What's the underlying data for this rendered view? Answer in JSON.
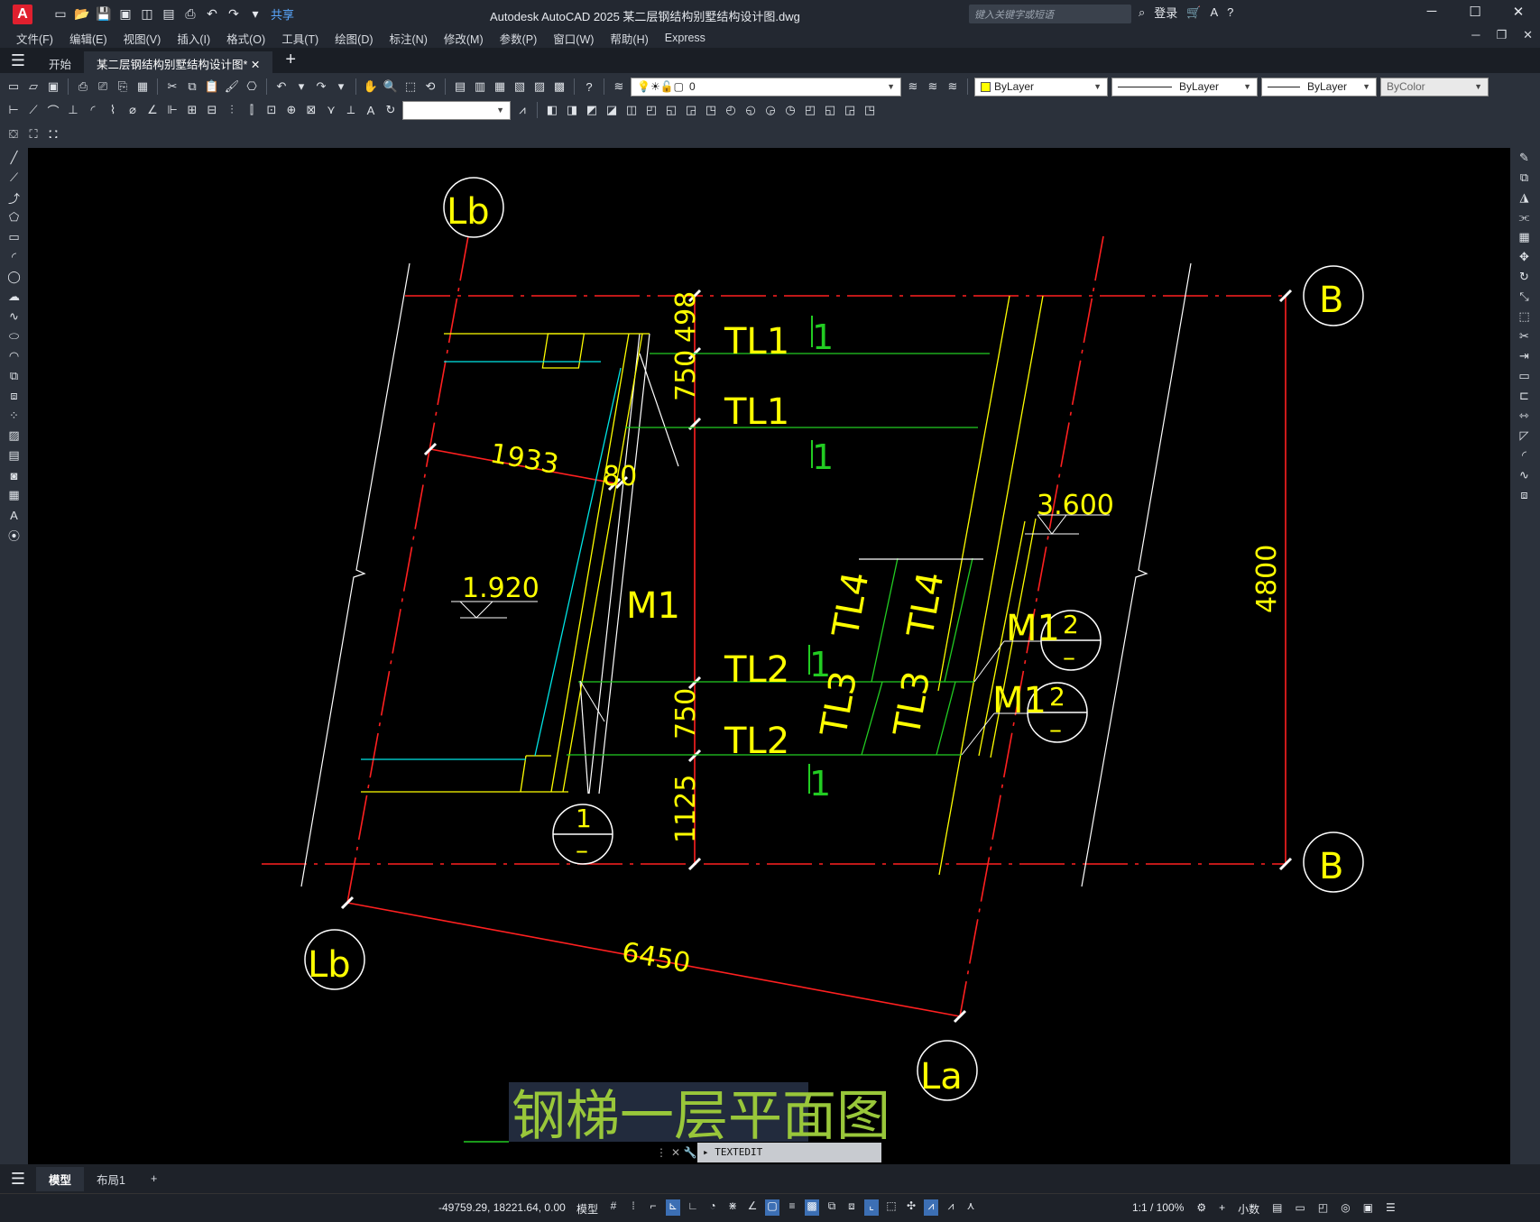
{
  "app": {
    "title": "Autodesk AutoCAD 2025    某二层钢结构别墅结构设计图.dwg",
    "logo": "A",
    "share": "共享",
    "search_placeholder": "键入关键字或短语",
    "login": "登录"
  },
  "menu": [
    "文件(F)",
    "编辑(E)",
    "视图(V)",
    "插入(I)",
    "格式(O)",
    "工具(T)",
    "绘图(D)",
    "标注(N)",
    "修改(M)",
    "参数(P)",
    "窗口(W)",
    "帮助(H)",
    "Express"
  ],
  "tabs": {
    "start": "开始",
    "active": "某二层钢结构别墅结构设计图*"
  },
  "properties": {
    "layer": "0",
    "color": "ByLayer",
    "linetype": "ByLayer",
    "lineweight": "ByLayer",
    "plotstyle": "ByColor"
  },
  "drawing": {
    "axis_lb": "Lb",
    "axis_la": "La",
    "axis_b": "B",
    "dim_1933": "1933",
    "dim_80": "80",
    "dim_750_top": "750",
    "dim_498": "498",
    "dim_750_mid": "750",
    "dim_1125": "1125",
    "dim_6450": "6450",
    "dim_4800": "4800",
    "elev_1920": "1.920",
    "elev_3600": "3.600",
    "tl1": "TL1",
    "tl2": "TL2",
    "tl3": "TL3",
    "tl4": "TL4",
    "m1": "M1",
    "section_1": "1",
    "section_2": "2",
    "section_mark": "1",
    "dash": "–",
    "caption": "钢梯一层平面图"
  },
  "command": {
    "text": "TEXTEDIT"
  },
  "layouts": {
    "model": "模型",
    "layout1": "布局1"
  },
  "status": {
    "coords": "-49759.29, 18221.64, 0.00",
    "model": "模型",
    "scale": "1:1 / 100%",
    "units": "小数"
  }
}
